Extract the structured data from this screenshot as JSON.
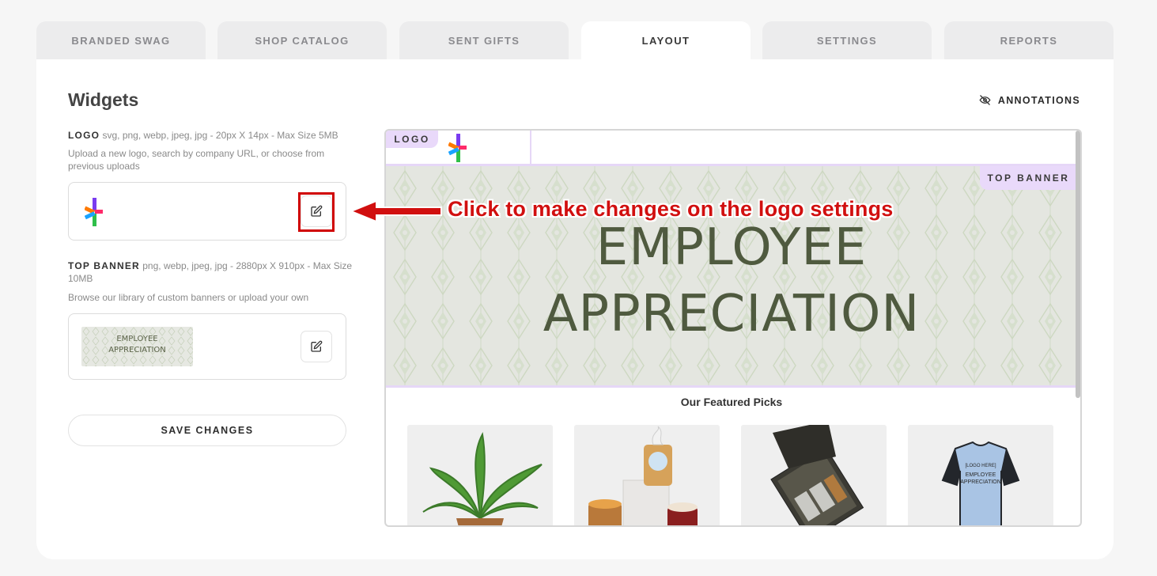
{
  "tabs": [
    {
      "label": "BRANDED SWAG",
      "active": false
    },
    {
      "label": "SHOP CATALOG",
      "active": false
    },
    {
      "label": "SENT GIFTS",
      "active": false
    },
    {
      "label": "LAYOUT",
      "active": true
    },
    {
      "label": "SETTINGS",
      "active": false
    },
    {
      "label": "REPORTS",
      "active": false
    }
  ],
  "widgets": {
    "title": "Widgets",
    "annotations_label": "ANNOTATIONS",
    "logo": {
      "label": "LOGO",
      "spec": "svg, png, webp, jpeg, jpg - 20px X 14px - Max Size 5MB",
      "help": "Upload a new logo, search by company URL, or choose from previous uploads"
    },
    "top_banner": {
      "label": "TOP BANNER",
      "spec": "png, webp, jpeg, jpg - 2880px X 910px - Max Size 10MB",
      "help": "Browse our library of custom banners or upload your own",
      "thumb_line1": "EMPLOYEE",
      "thumb_line2": "APPRECIATION"
    },
    "save_label": "SAVE CHANGES"
  },
  "preview": {
    "logo_badge": "LOGO",
    "banner_badge": "TOP BANNER",
    "banner_line1": "EMPLOYEE",
    "banner_line2": "APPRECIATION",
    "featured_title": "Our Featured Picks",
    "products": [
      {
        "icon": "plant-image"
      },
      {
        "icon": "candle-set-image"
      },
      {
        "icon": "gift-box-image"
      },
      {
        "icon": "jersey-image",
        "text_1": "[LOGO HERE]",
        "text_2": "EMPLOYEE",
        "text_3": "APPRECIATION"
      }
    ]
  },
  "callout": {
    "text": "Click to make changes on the logo settings",
    "color": "#d10f0f"
  },
  "colors": {
    "accent_lavender": "#e9d9fa",
    "banner_text": "#4f5a3f",
    "highlight_red": "#d00000"
  }
}
